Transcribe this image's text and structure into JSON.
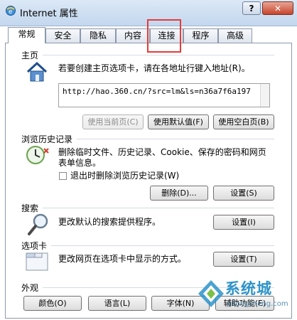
{
  "window": {
    "title": "Internet 属性",
    "help_label": "?",
    "close_label": "✕"
  },
  "tabs": [
    {
      "label": "常规"
    },
    {
      "label": "安全"
    },
    {
      "label": "隐私"
    },
    {
      "label": "内容"
    },
    {
      "label": "连接"
    },
    {
      "label": "程序"
    },
    {
      "label": "高级"
    }
  ],
  "home": {
    "header": "主页",
    "description": "若要创建主页选项卡，请在各地址行键入地址(R)。",
    "url": "http://hao.360.cn/?src=lm&ls=n36a7f6a197",
    "use_current": "使用当前页(C)",
    "use_default": "使用默认值(F)",
    "use_blank": "使用空白页(B)"
  },
  "history": {
    "header": "浏览历史记录",
    "description_line1": "删除临时文件、历史记录、Cookie、保存的密码和网页",
    "description_line2": "表单信息。",
    "checkbox_label": "退出时删除浏览历史记录(W)",
    "delete_label": "删除(D)...",
    "settings_label": "设置(S)"
  },
  "search": {
    "header": "搜索",
    "description": "更改默认的搜索提供程序。",
    "settings_label": "设置(I)"
  },
  "tabs_section": {
    "header": "选项卡",
    "description": "更改网页在选项卡中显示的方式。",
    "settings_label": "设置(T)"
  },
  "appearance": {
    "header": "外观",
    "colors_label": "颜色(O)",
    "languages_label": "语言(L)",
    "fonts_label": "字体(N)",
    "accessibility_label": "辅助功能(E)"
  },
  "watermark": {
    "brand": "系统城",
    "domain": "xitongcheng.com"
  }
}
